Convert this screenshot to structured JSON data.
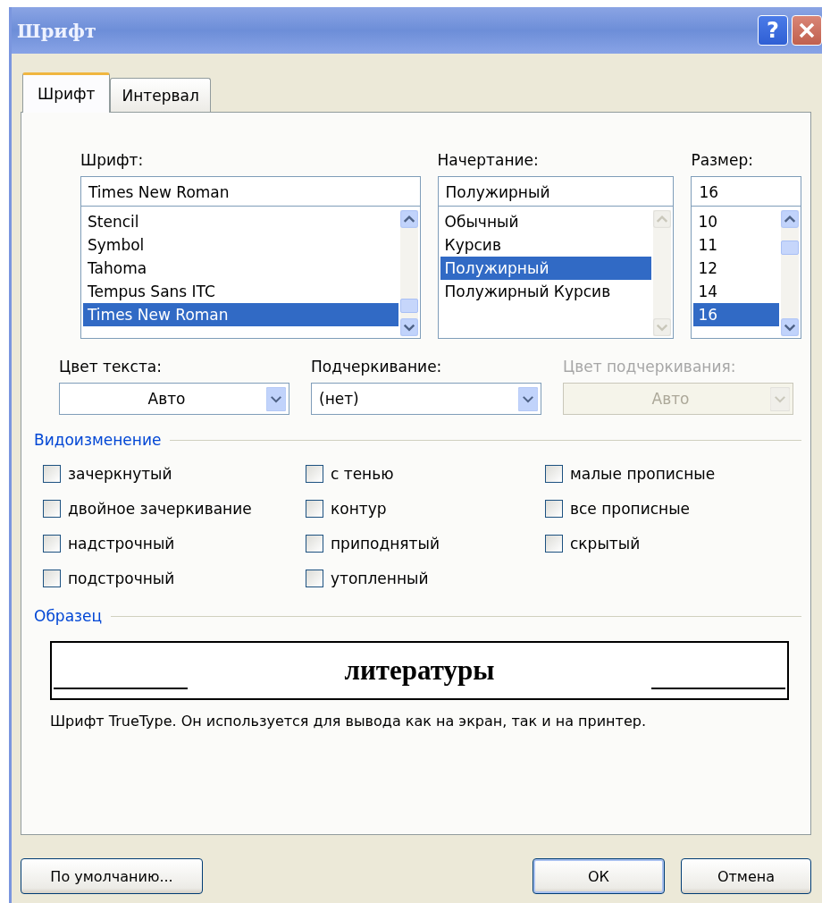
{
  "window": {
    "title": "Шрифт",
    "help_button": "?"
  },
  "tabs": [
    {
      "label": "Шрифт",
      "selected": true
    },
    {
      "label": "Интервал",
      "selected": false
    }
  ],
  "font": {
    "label": "Шрифт:",
    "value": "Times New Roman",
    "items": [
      {
        "label": "Stencil",
        "selected": false
      },
      {
        "label": "Symbol",
        "selected": false
      },
      {
        "label": "Tahoma",
        "selected": false
      },
      {
        "label": "Tempus Sans ITC",
        "selected": false
      },
      {
        "label": "Times New Roman",
        "selected": true
      }
    ],
    "scroll_disabled": false
  },
  "style": {
    "label": "Начертание:",
    "value": "Полужирный",
    "items": [
      {
        "label": "Обычный",
        "selected": false
      },
      {
        "label": "Курсив",
        "selected": false
      },
      {
        "label": "Полужирный",
        "selected": true
      },
      {
        "label": "Полужирный Курсив",
        "selected": false
      }
    ],
    "scroll_disabled": true
  },
  "size": {
    "label": "Размер:",
    "value": "16",
    "items": [
      {
        "label": "10",
        "selected": false
      },
      {
        "label": "11",
        "selected": false
      },
      {
        "label": "12",
        "selected": false
      },
      {
        "label": "14",
        "selected": false
      },
      {
        "label": "16",
        "selected": true
      }
    ],
    "scroll_disabled": false
  },
  "combos": [
    {
      "label": "Цвет текста:",
      "value": "Авто",
      "centered": true,
      "disabled": false
    },
    {
      "label": "Подчеркивание:",
      "value": "(нет)",
      "centered": false,
      "disabled": false
    },
    {
      "label": "Цвет подчеркивания:",
      "value": "Авто",
      "centered": true,
      "disabled": true
    }
  ],
  "effects": {
    "title": "Видоизменение",
    "columns": [
      [
        {
          "label": "зачеркнутый",
          "checked": false
        },
        {
          "label": "двойное зачеркивание",
          "checked": false
        },
        {
          "label": "надстрочный",
          "checked": false
        },
        {
          "label": "подстрочный",
          "checked": false
        }
      ],
      [
        {
          "label": "с тенью",
          "checked": false
        },
        {
          "label": "контур",
          "checked": false
        },
        {
          "label": "приподнятый",
          "checked": false
        },
        {
          "label": "утопленный",
          "checked": false
        }
      ],
      [
        {
          "label": "малые прописные",
          "checked": false
        },
        {
          "label": "все прописные",
          "checked": false
        },
        {
          "label": "скрытый",
          "checked": false
        }
      ]
    ]
  },
  "preview": {
    "title": "Образец",
    "sample": "литературы",
    "description": "Шрифт TrueType. Он используется для вывода как на экран, так и на принтер."
  },
  "buttons": {
    "default": "По умолчанию...",
    "ok": "ОК",
    "cancel": "Отмена"
  }
}
